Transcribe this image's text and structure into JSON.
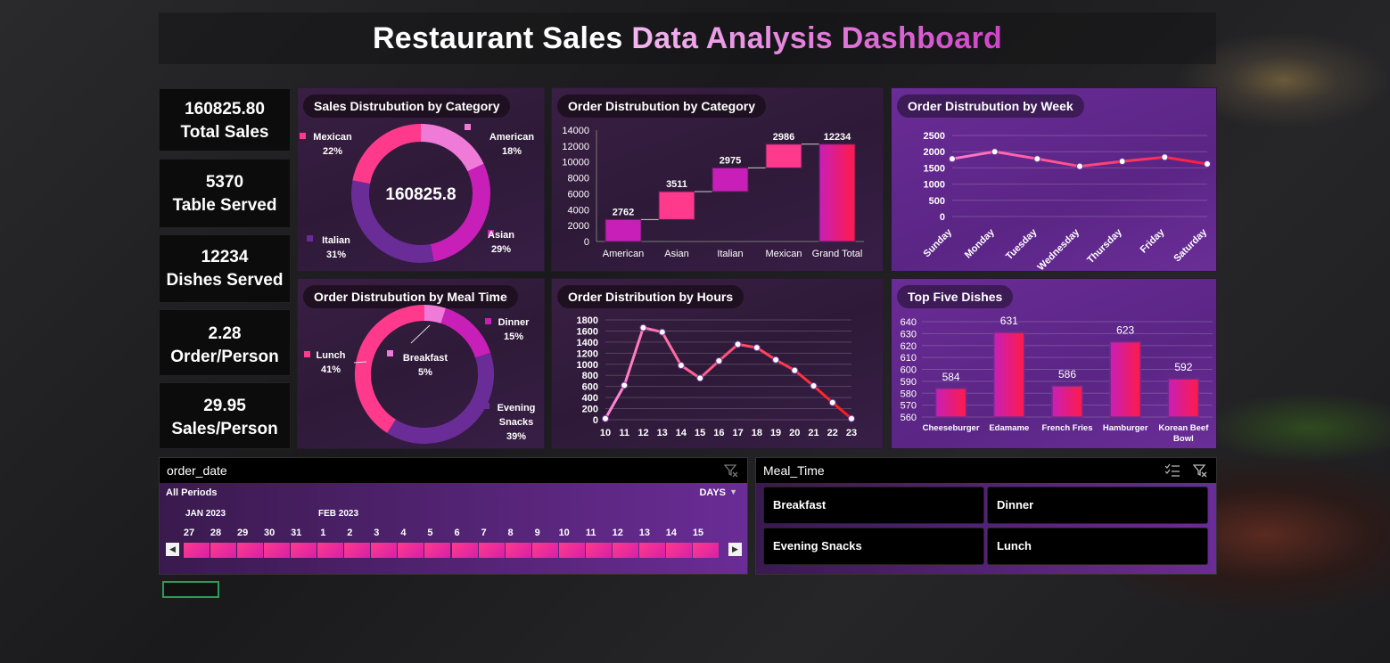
{
  "header": {
    "title_part1": "Restaurant Sales",
    "title_part2": "Data Analysis Dashboard"
  },
  "kpis": [
    {
      "value": "160825.80",
      "label": "Total Sales"
    },
    {
      "value": "5370",
      "label": "Table Served"
    },
    {
      "value": "12234",
      "label": "Dishes Served"
    },
    {
      "value": "2.28",
      "label": "Order/Person"
    },
    {
      "value": "29.95",
      "label": "Sales/Person"
    }
  ],
  "panels": {
    "sales_by_category": "Sales Distrubution by Category",
    "order_by_category": "Order Distrubution by Category",
    "order_by_week": "Order Distrubution by Week",
    "order_by_mealtime": "Order Distrubution by Meal Time",
    "order_by_hours": "Order Distribution by Hours",
    "top_dishes": "Top Five Dishes"
  },
  "chart_data": [
    {
      "id": "sales_by_category",
      "type": "pie",
      "center_label": "160825.8",
      "labels": [
        "American",
        "Asian",
        "Italian",
        "Mexican"
      ],
      "values": [
        18,
        29,
        31,
        22
      ],
      "value_labels": [
        "18%",
        "29%",
        "31%",
        "22%"
      ],
      "colors": [
        "#f07ad8",
        "#c81fb8",
        "#6a2c96",
        "#ff3a8c"
      ]
    },
    {
      "id": "order_by_category",
      "type": "bar",
      "categories": [
        "American",
        "Asian",
        "Italian",
        "Mexican",
        "Grand Total"
      ],
      "values": [
        2762,
        3511,
        2975,
        2986,
        12234
      ],
      "ylim": [
        0,
        14000
      ],
      "yticks": [
        "0",
        "2000",
        "4000",
        "6000",
        "8000",
        "10000",
        "12000",
        "14000"
      ]
    },
    {
      "id": "order_by_week",
      "type": "line",
      "categories": [
        "Sunday",
        "Monday",
        "Tuesday",
        "Wednesday",
        "Thursday",
        "Friday",
        "Saturday"
      ],
      "values": [
        1780,
        2000,
        1780,
        1550,
        1700,
        1830,
        1620
      ],
      "ylim": [
        0,
        2500
      ],
      "yticks": [
        "0",
        "500",
        "1000",
        "1500",
        "2000",
        "2500"
      ]
    },
    {
      "id": "order_by_mealtime",
      "type": "pie",
      "labels": [
        "Breakfast",
        "Dinner",
        "Evening Snacks",
        "Lunch"
      ],
      "values": [
        5,
        15,
        39,
        41
      ],
      "value_labels": [
        "5%",
        "15%",
        "39%",
        "41%"
      ],
      "colors": [
        "#f07ad8",
        "#c81fb8",
        "#6a2c96",
        "#ff3a8c"
      ]
    },
    {
      "id": "order_by_hours",
      "type": "line",
      "categories": [
        "10",
        "11",
        "12",
        "13",
        "14",
        "15",
        "16",
        "17",
        "18",
        "19",
        "20",
        "21",
        "22",
        "23"
      ],
      "values": [
        20,
        620,
        1660,
        1580,
        980,
        750,
        1060,
        1360,
        1300,
        1080,
        890,
        610,
        310,
        20
      ],
      "ylim": [
        0,
        1800
      ],
      "yticks": [
        "0",
        "200",
        "400",
        "600",
        "800",
        "1000",
        "1200",
        "1400",
        "1600",
        "1800"
      ]
    },
    {
      "id": "top_dishes",
      "type": "bar",
      "categories": [
        "Cheeseburger",
        "Edamame",
        "French Fries",
        "Hamburger",
        "Korean Beef Bowl"
      ],
      "values": [
        584,
        631,
        586,
        623,
        592
      ],
      "ylim": [
        560,
        640
      ],
      "yticks": [
        "560",
        "570",
        "580",
        "590",
        "600",
        "610",
        "620",
        "630",
        "640"
      ]
    }
  ],
  "timeline": {
    "field": "order_date",
    "period_label": "All Periods",
    "level": "DAYS",
    "months": [
      "JAN 2023",
      "FEB 2023"
    ],
    "days": [
      "27",
      "28",
      "29",
      "30",
      "31",
      "1",
      "2",
      "3",
      "4",
      "5",
      "6",
      "7",
      "8",
      "9",
      "10",
      "11",
      "12",
      "13",
      "14",
      "15"
    ]
  },
  "meal_slicer": {
    "field": "Meal_Time",
    "items": [
      "Breakfast",
      "Dinner",
      "Evening Snacks",
      "Lunch"
    ]
  },
  "colors": {
    "pink": "#ff3a8c",
    "magenta": "#c81fb8",
    "purple": "#6a2c96",
    "light_pink": "#f07ad8"
  }
}
